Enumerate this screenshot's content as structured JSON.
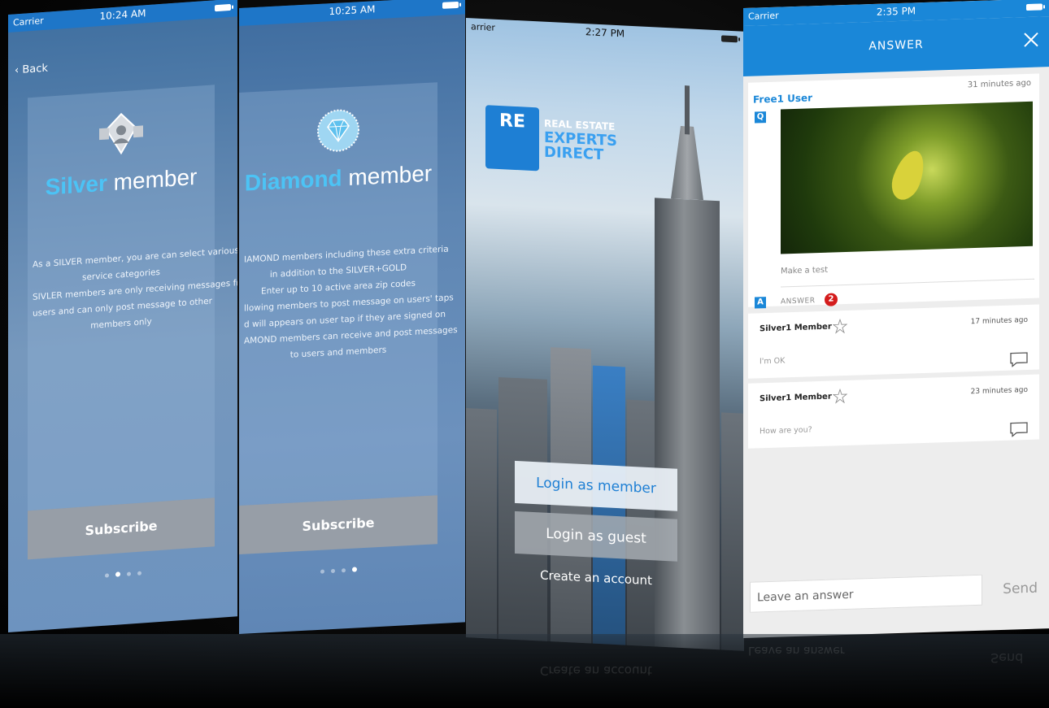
{
  "screen_silver": {
    "status": {
      "carrier": "Carrier",
      "time": "10:24 AM"
    },
    "back_label": "Back",
    "title_highlight": "Silver",
    "title_rest": " member",
    "description": [
      "As a SILVER member, you are can select various of",
      "service categories",
      "SIVLER members are only receiving messages from",
      "users and can only post message to other",
      "members only"
    ],
    "subscribe_label": "Subscribe",
    "page_index": 2,
    "page_count": 4
  },
  "screen_diamond": {
    "status": {
      "time": "10:25 AM"
    },
    "title_highlight": "Diamond",
    "title_rest": " member",
    "description": [
      "IAMOND members including these extra criteria",
      "in addition to the SILVER+GOLD",
      "Enter up to 10 active area zip codes",
      "llowing members to post message on users' taps",
      "d will appears on user tap if they are signed on",
      "AMOND members can receive and post messages",
      "to users and members"
    ],
    "subscribe_label": "Subscribe",
    "page_index": 4,
    "page_count": 4
  },
  "screen_login": {
    "status": {
      "carrier": "arrier",
      "time": "2:27 PM"
    },
    "logo": {
      "mark": "RE",
      "line1": "REAL ESTATE",
      "line2": "EXPERTS",
      "line3": "DIRECT"
    },
    "login_member_label": "Login as member",
    "login_guest_label": "Login as guest",
    "create_account_label": "Create an account"
  },
  "screen_answer": {
    "status": {
      "carrier": "Carrier",
      "time": "2:35 PM"
    },
    "title": "ANSWER",
    "question": {
      "user": "Free1 User",
      "ago": "31 minutes ago",
      "q_tag": "Q",
      "text": "Make a test",
      "a_tag": "A",
      "answer_label": "ANSWER",
      "answer_count": "2"
    },
    "replies": [
      {
        "name": "Silver1 Member",
        "time": "17 minutes ago",
        "message": "I'm OK"
      },
      {
        "name": "Silver1 Member",
        "time": "23 minutes ago",
        "message": "How are you?"
      }
    ],
    "input_placeholder": "Leave an answer",
    "send_label": "Send"
  },
  "colors": {
    "accent": "#1a87d8",
    "highlight": "#4cc3f5",
    "badge_red": "#d41c1c"
  },
  "icons": [
    "wifi-icon",
    "battery-icon",
    "back-chevron-icon",
    "silver-badge-icon",
    "diamond-badge-icon",
    "close-icon",
    "rank-star-icon",
    "comment-icon"
  ]
}
